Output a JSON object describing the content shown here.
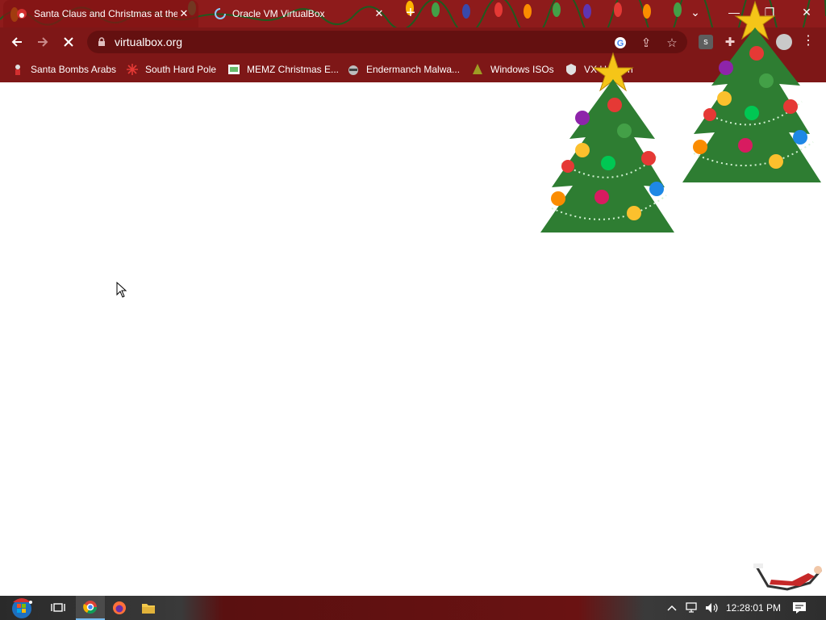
{
  "tabs": [
    {
      "title": "Santa Claus and Christmas at the",
      "active": true,
      "favicon": "santa-favicon"
    },
    {
      "title": "Oracle VM VirtualBox",
      "active": false,
      "favicon": "loading-spinner"
    }
  ],
  "toolbar": {
    "url": "virtualbox.org",
    "extension_label": "s"
  },
  "bookmarks": [
    {
      "label": "Santa Bombs Arabs",
      "icon": "santa-bookmark-icon"
    },
    {
      "label": "South Hard Pole",
      "icon": "snowflake-bookmark-icon"
    },
    {
      "label": "MEMZ Christmas E...",
      "icon": "memz-bookmark-icon"
    },
    {
      "label": "Endermanch Malwa...",
      "icon": "raccoon-bookmark-icon"
    },
    {
      "label": "Windows ISOs",
      "icon": "tree-bookmark-icon"
    },
    {
      "label": "VX Heaven",
      "icon": "shield-bookmark-icon"
    }
  ],
  "taskbar": {
    "time": "12:28:01 PM"
  },
  "colors": {
    "frame": "#8e1b1b",
    "toolbar": "#7e1717",
    "omnibox": "#641010",
    "tree_green": "#2e7d32"
  }
}
